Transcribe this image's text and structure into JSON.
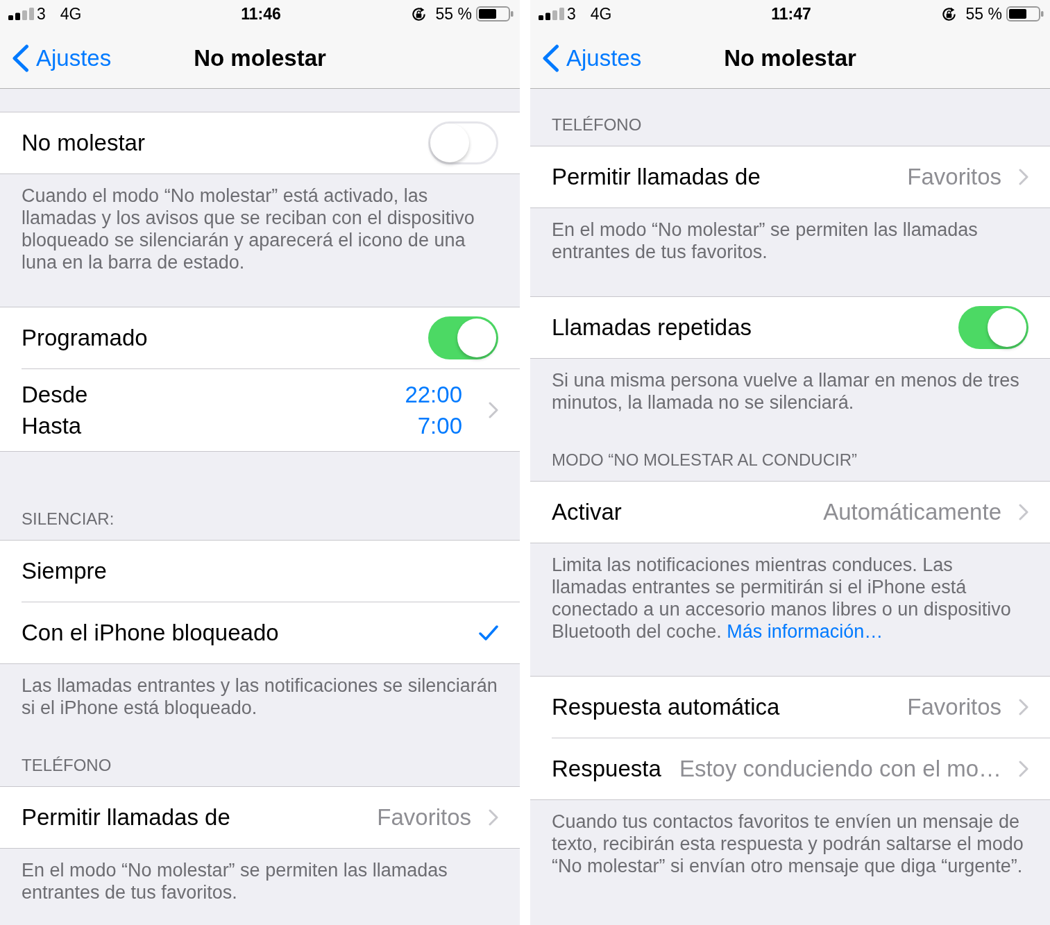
{
  "screens": [
    {
      "status_bar": {
        "carrier": "3",
        "network": "4G",
        "time": "11:46",
        "battery_percent": "55 %"
      },
      "nav_bar": {
        "back": "Ajustes",
        "title": "No molestar"
      },
      "sections": [
        {
          "rows": [
            {
              "kind": "toggle",
              "label": "No molestar",
              "on": false
            }
          ],
          "footer": "Cuando el modo “No molestar” está activado, las llamadas y los avisos que se reciban con el dispositivo bloqueado se silenciarán y aparecerá el icono de una luna en la barra de estado."
        },
        {
          "rows": [
            {
              "kind": "toggle",
              "label": "Programado",
              "on": true
            },
            {
              "kind": "schedule",
              "from_label": "Desde",
              "from_value": "22:00",
              "to_label": "Hasta",
              "to_value": "7:00"
            }
          ]
        },
        {
          "header": "SILENCIAR:",
          "rows": [
            {
              "kind": "option",
              "label": "Siempre",
              "selected": false
            },
            {
              "kind": "option",
              "label": "Con el iPhone bloqueado",
              "selected": true
            }
          ],
          "footer": "Las llamadas entrantes y las notificaciones se silenciarán si el iPhone está bloqueado."
        },
        {
          "header": "TELÉFONO",
          "rows": [
            {
              "kind": "disclosure",
              "label": "Permitir llamadas de",
              "value": "Favoritos"
            }
          ],
          "footer": "En el modo “No molestar” se permiten las llamadas entrantes de tus favoritos."
        }
      ]
    },
    {
      "status_bar": {
        "carrier": "3",
        "network": "4G",
        "time": "11:47",
        "battery_percent": "55 %"
      },
      "nav_bar": {
        "back": "Ajustes",
        "title": "No molestar"
      },
      "sections": [
        {
          "header": "TELÉFONO",
          "rows": [
            {
              "kind": "disclosure",
              "label": "Permitir llamadas de",
              "value": "Favoritos"
            }
          ],
          "footer": "En el modo “No molestar” se permiten las llamadas entrantes de tus favoritos."
        },
        {
          "rows": [
            {
              "kind": "toggle",
              "label": "Llamadas repetidas",
              "on": true
            }
          ],
          "footer": "Si una misma persona vuelve a llamar en menos de tres minutos, la llamada no se silenciará."
        },
        {
          "header": "MODO “NO MOLESTAR AL CONDUCIR”",
          "rows": [
            {
              "kind": "disclosure",
              "label": "Activar",
              "value": "Automáticamente"
            }
          ],
          "footer": "Limita las notificaciones mientras conduces. Las llamadas entrantes se permitirán si el iPhone está conectado a un accesorio manos libres o un dispositivo Bluetooth del coche.",
          "footer_link": "Más información…"
        },
        {
          "rows": [
            {
              "kind": "disclosure",
              "label": "Respuesta automática",
              "value": "Favoritos"
            },
            {
              "kind": "disclosure",
              "label": "Respuesta",
              "value": "Estoy conduciendo con el mo…"
            }
          ],
          "footer": "Cuando tus contactos favoritos te envíen un mensaje de texto, recibirán esta respuesta y podrán saltarse el modo “No molestar” si envían otro mensaje que diga “urgente”."
        }
      ]
    }
  ]
}
